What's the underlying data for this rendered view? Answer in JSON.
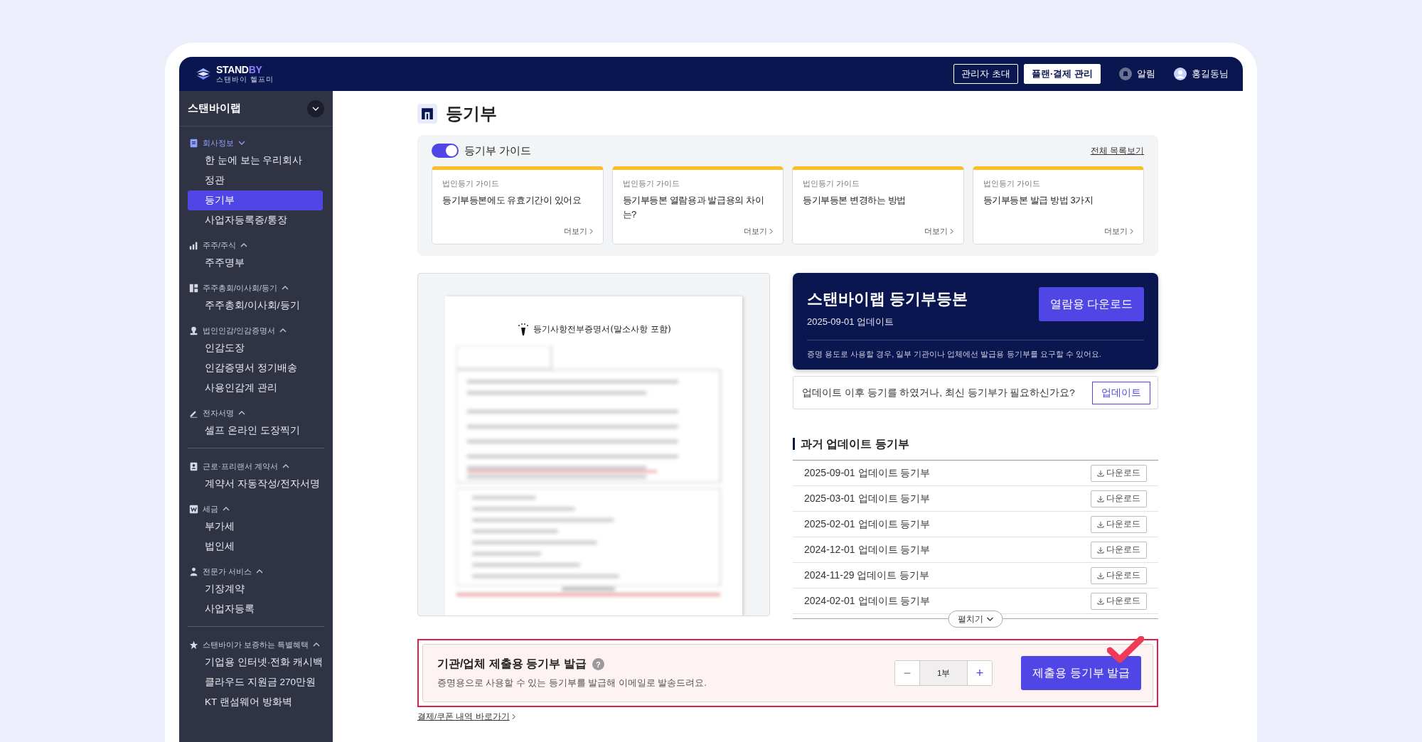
{
  "header": {
    "logo": {
      "main": "STAND",
      "accent": "BY",
      "subtitle": "스탠바이 헬프미"
    },
    "buttons": [
      {
        "label": "관리자 초대",
        "kind": "outline"
      },
      {
        "label": "플랜·결제 관리",
        "kind": "filled"
      }
    ],
    "alerts": "알림",
    "user": "홍길동님"
  },
  "sidebar": {
    "company": "스탠바이랩",
    "sections": [
      {
        "label": "회사정보",
        "active": true,
        "expanded": true,
        "divider_before": false,
        "items": [
          {
            "label": "한 눈에 보는 우리회사",
            "selected": false
          },
          {
            "label": "정관",
            "selected": false
          },
          {
            "label": "등기부",
            "selected": true
          },
          {
            "label": "사업자등록증/통장",
            "selected": false
          }
        ]
      },
      {
        "label": "주주/주식",
        "active": false,
        "expanded": false,
        "divider_before": false,
        "items": [
          {
            "label": "주주명부",
            "selected": false
          }
        ]
      },
      {
        "label": "주주총회/이사회/등기",
        "active": false,
        "expanded": false,
        "divider_before": false,
        "items": [
          {
            "label": "주주총회/이사회/등기",
            "selected": false
          }
        ]
      },
      {
        "label": "법인인감/인감증명서",
        "active": false,
        "expanded": false,
        "divider_before": false,
        "items": [
          {
            "label": "인감도장",
            "selected": false
          },
          {
            "label": "인감증명서 정기배송",
            "selected": false
          },
          {
            "label": "사용인감계 관리",
            "selected": false
          }
        ]
      },
      {
        "label": "전자서명",
        "active": false,
        "expanded": false,
        "divider_before": false,
        "items": [
          {
            "label": "셀프 온라인 도장찍기",
            "selected": false
          }
        ]
      },
      {
        "label": "근로·프리랜서 계약서",
        "active": false,
        "expanded": false,
        "divider_before": true,
        "items": [
          {
            "label": "계약서 자동작성/전자서명",
            "selected": false
          }
        ]
      },
      {
        "label": "세금",
        "active": false,
        "expanded": false,
        "divider_before": false,
        "items": [
          {
            "label": "부가세",
            "selected": false
          },
          {
            "label": "법인세",
            "selected": false
          }
        ]
      },
      {
        "label": "전문가 서비스",
        "active": false,
        "expanded": false,
        "divider_before": false,
        "items": [
          {
            "label": "기장계약",
            "selected": false
          },
          {
            "label": "사업자등록",
            "selected": false
          }
        ]
      },
      {
        "label": "스탠바이가 보증하는 특별혜택",
        "active": false,
        "expanded": false,
        "divider_before": true,
        "items": [
          {
            "label": "기업용 인터넷·전화 캐시백",
            "selected": false
          },
          {
            "label": "클라우드 지원금 270만원",
            "selected": false
          },
          {
            "label": "KT 랜섬웨어 방화벽",
            "selected": false
          }
        ]
      }
    ]
  },
  "page": {
    "title": "등기부"
  },
  "guide": {
    "label": "등기부 가이드",
    "on": true,
    "all_link": "전체 목록보기",
    "cards": [
      {
        "category": "법인등기 가이드",
        "title": "등기부등본에도 유효기간이 있어요",
        "more": "더보기"
      },
      {
        "category": "법인등기 가이드",
        "title": "등기부등본 열람용과 발급용의 차이는?",
        "more": "더보기"
      },
      {
        "category": "법인등기 가이드",
        "title": "등기부등본 변경하는 방법",
        "more": "더보기"
      },
      {
        "category": "법인등기 가이드",
        "title": "등기부등본 발급 방법 3가지",
        "more": "더보기"
      }
    ]
  },
  "preview": {
    "document_title": "등기사항전부증명서(말소사항 포함)"
  },
  "registry_card": {
    "title": "스탠바이랩 등기부등본",
    "updated": "2025-09-01 업데이트",
    "button": "열람용 다운로드",
    "note": "증명 용도로 사용할 경우, 일부 기관이나 업체에선 발급용 등기부를 요구할 수 있어요."
  },
  "update_row": {
    "text": "업데이트 이후 등기를 하였거나, 최신 등기부가 필요하신가요?",
    "button": "업데이트"
  },
  "history": {
    "title": "과거 업데이트 등기부",
    "expand": "펼치기",
    "rows": [
      {
        "label": "2025-09-01 업데이트 등기부",
        "button": "다운로드"
      },
      {
        "label": "2025-03-01 업데이트 등기부",
        "button": "다운로드"
      },
      {
        "label": "2025-02-01 업데이트 등기부",
        "button": "다운로드"
      },
      {
        "label": "2024-12-01 업데이트 등기부",
        "button": "다운로드"
      },
      {
        "label": "2024-11-29 업데이트 등기부",
        "button": "다운로드"
      },
      {
        "label": "2024-02-01 업데이트 등기부",
        "button": "다운로드"
      }
    ]
  },
  "issue": {
    "title": "기관/업체 제출용 등기부 발급",
    "help": "?",
    "description": "증명용으로 사용할 수 있는 등기부를 발급해 이메일로 발송드려요.",
    "minus": "−",
    "quantity": "1부",
    "plus": "+",
    "button": "제출용 등기부 발급",
    "highlighted": true
  },
  "payment_link": "결제/쿠폰 내역 바로가기"
}
